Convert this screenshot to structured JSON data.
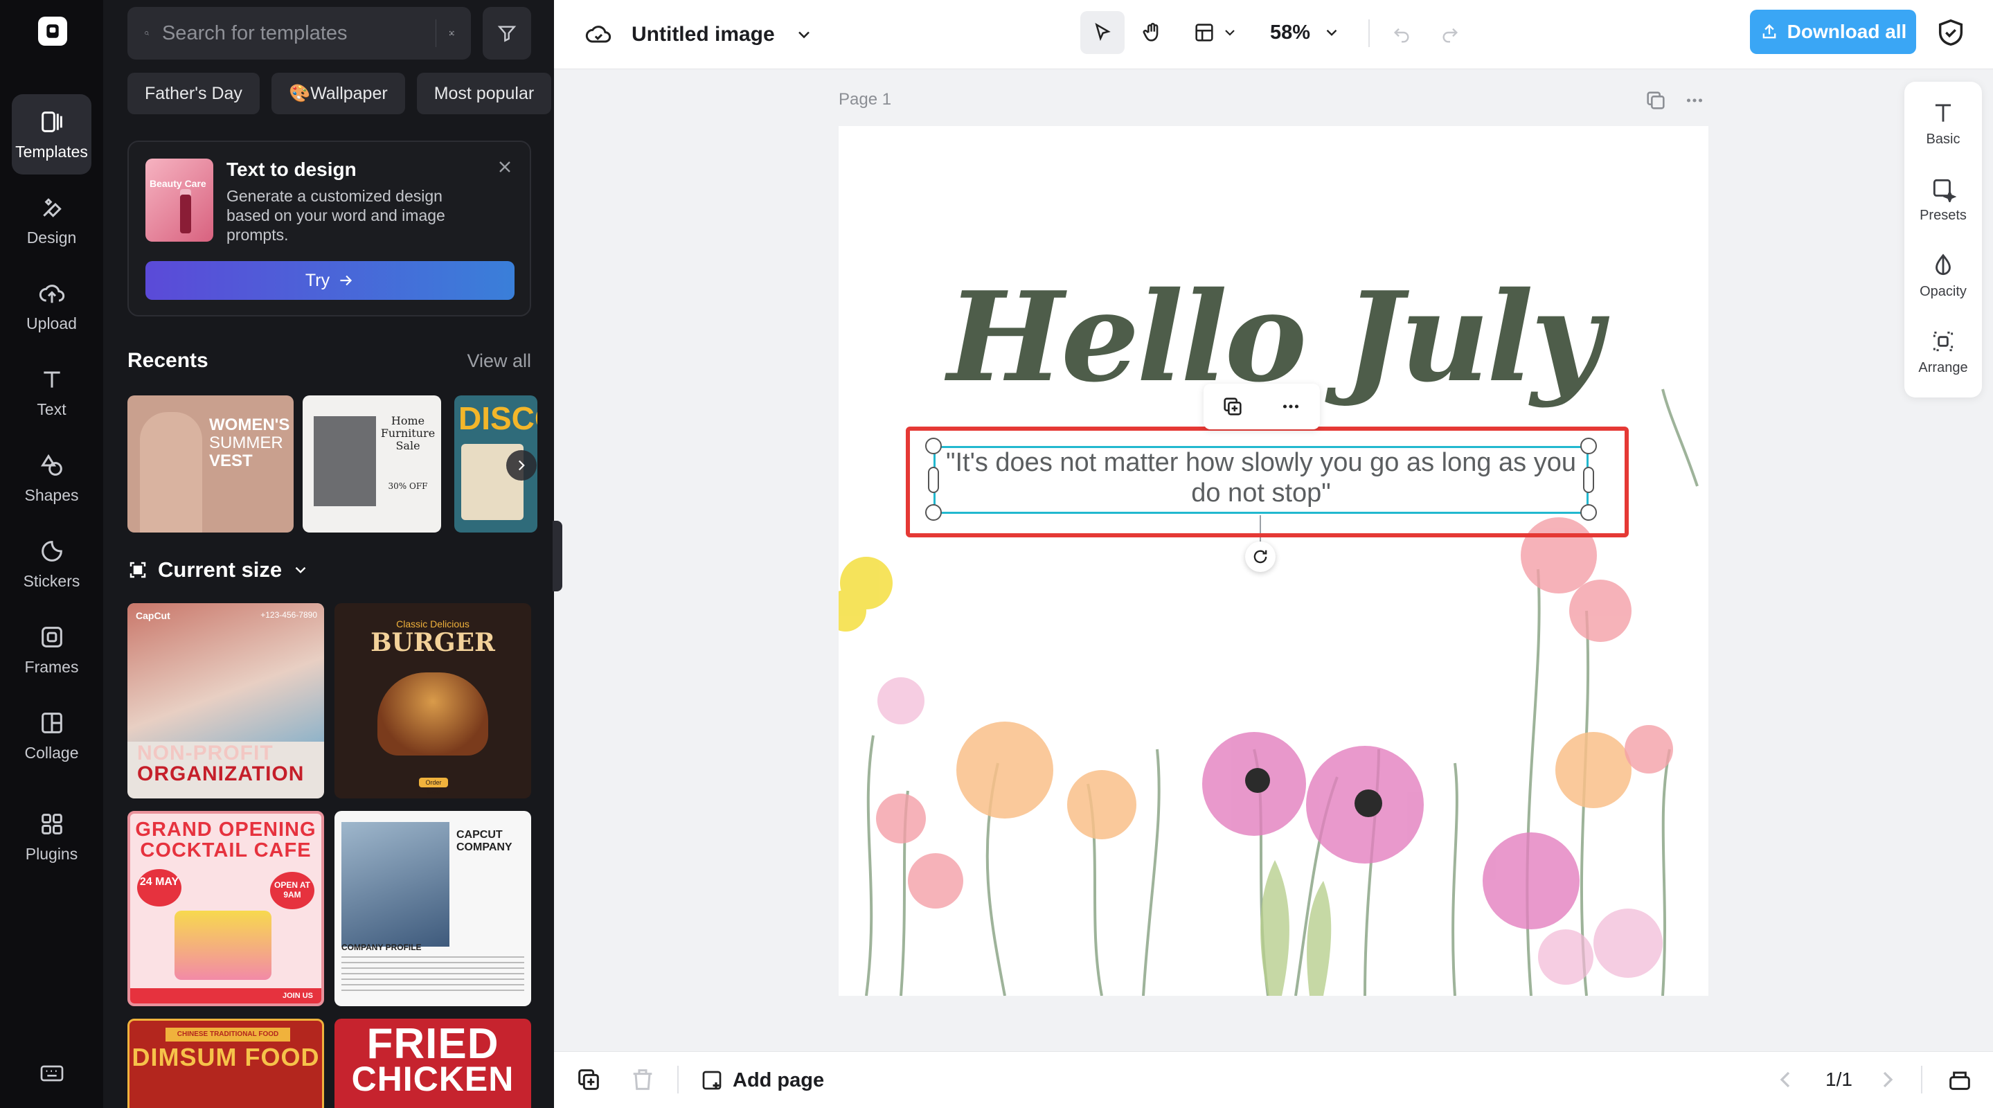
{
  "rail": {
    "items": [
      {
        "label": "Templates",
        "icon": "templates-icon"
      },
      {
        "label": "Design",
        "icon": "design-icon"
      },
      {
        "label": "Upload",
        "icon": "upload-icon"
      },
      {
        "label": "Text",
        "icon": "text-icon"
      },
      {
        "label": "Shapes",
        "icon": "shapes-icon"
      },
      {
        "label": "Stickers",
        "icon": "stickers-icon"
      },
      {
        "label": "Frames",
        "icon": "frames-icon"
      },
      {
        "label": "Collage",
        "icon": "collage-icon"
      },
      {
        "label": "Plugins",
        "icon": "plugins-icon"
      }
    ]
  },
  "panel": {
    "search_placeholder": "Search for templates",
    "chips": [
      "Father's Day",
      "🎨Wallpaper",
      "Most popular"
    ],
    "promo": {
      "thumb_text": "Beauty Care",
      "title": "Text to design",
      "description": "Generate a customized design based on your word and image prompts.",
      "button": "Try"
    },
    "recents_title": "Recents",
    "view_all": "View all",
    "recents": [
      {
        "line1": "WOMEN'S",
        "line2": "SUMMER",
        "line3": "VEST"
      },
      {
        "line1": "Home",
        "line2": "Furniture",
        "line3": "Sale",
        "line4": "30% OFF"
      },
      {
        "line1": "DISCO"
      }
    ],
    "current_size": "Current size",
    "templates": [
      {
        "brand": "CapCut",
        "phone": "+123-456-7890",
        "line1": "NON-PROFIT",
        "line2": "ORGANIZATION"
      },
      {
        "kicker": "Classic Delicious",
        "title": "BURGER",
        "cta": "Order Now"
      },
      {
        "line1": "GRAND OPENING",
        "line2": "COCKTAIL CAFE",
        "date": "24 MAY",
        "badge": "OPEN AT 9AM",
        "cta": "JOIN US"
      },
      {
        "line1": "CAPCUT",
        "line2": "COMPANY",
        "label": "COMPANY PROFILE"
      },
      {
        "kicker": "CHINESE TRADITIONAL FOOD",
        "title": "DIMSUM FOOD"
      },
      {
        "line1": "FRIED",
        "line2": "CHICKEN"
      }
    ]
  },
  "topbar": {
    "doc_title": "Untitled image",
    "zoom": "58%",
    "download": "Download all"
  },
  "canvas": {
    "page_label": "Page 1",
    "heading": "Hello July",
    "quote": "\"It's does not matter how slowly you go as long as you do not stop\""
  },
  "props": [
    {
      "label": "Basic"
    },
    {
      "label": "Presets"
    },
    {
      "label": "Opacity"
    },
    {
      "label": "Arrange"
    }
  ],
  "bottombar": {
    "add_page": "Add page",
    "pager": "1/1"
  },
  "colors": {
    "accent_blue": "#3aa6f5",
    "selection_red": "#e53935",
    "selection_cyan": "#22b8cf",
    "heading_green": "#4e5d4a"
  }
}
